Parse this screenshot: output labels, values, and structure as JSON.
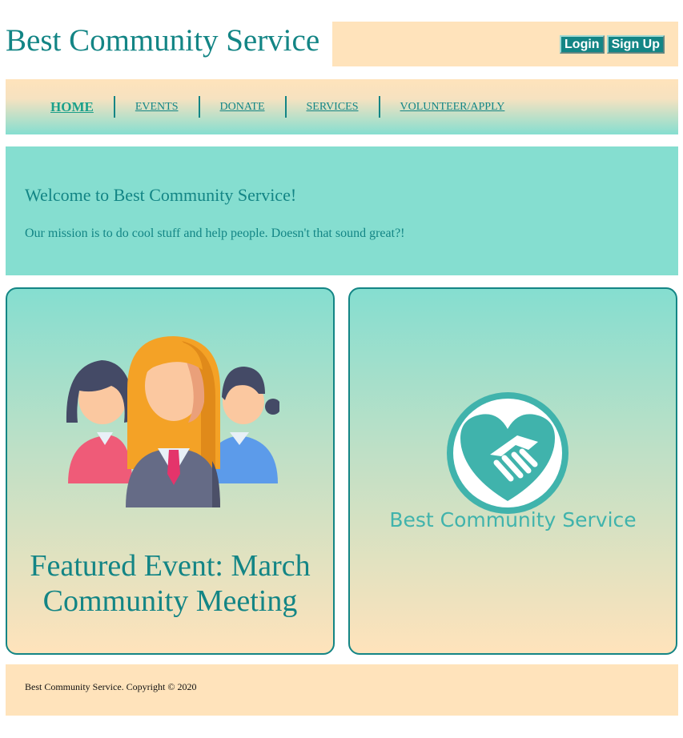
{
  "header": {
    "site_title": "Best Community Service",
    "login_label": "Login",
    "signup_label": "Sign Up"
  },
  "nav": {
    "items": [
      {
        "label": "HOME",
        "active": true
      },
      {
        "label": "EVENTS"
      },
      {
        "label": "DONATE"
      },
      {
        "label": "SERVICES"
      },
      {
        "label": "VOLUNTEER/APPLY"
      }
    ]
  },
  "welcome": {
    "title": "Welcome to Best Community Service!",
    "text": "Our mission is to do cool stuff and help people. Doesn't that sound great?!"
  },
  "cards": {
    "featured": {
      "title": "Featured Event: March Community Meeting",
      "image_icon": "people-icon"
    },
    "logo": {
      "icon": "handshake-heart-icon",
      "text": "Best Community Service"
    }
  },
  "footer": {
    "copyright": "Best Community Service. Copyright © 2020"
  },
  "colors": {
    "teal_text": "#138585",
    "aqua": "#85ded0",
    "peach": "#ffe3bb",
    "logo_teal": "#40b3ac"
  }
}
